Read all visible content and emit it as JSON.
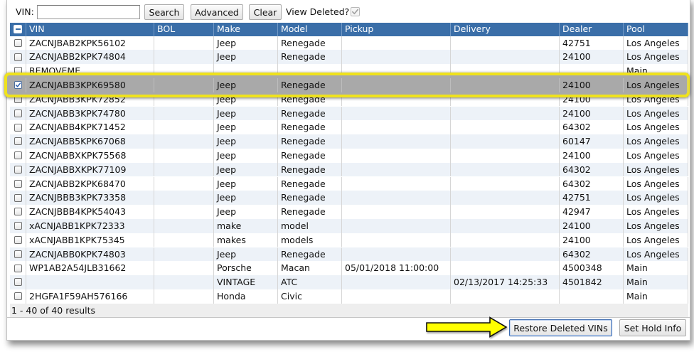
{
  "search": {
    "vin_label": "VIN:",
    "vin_value": "",
    "search_button": "Search",
    "advanced_button": "Advanced",
    "clear_button": "Clear",
    "view_deleted_label": "View Deleted?",
    "view_deleted_checked": true,
    "view_deleted_disabled": true
  },
  "table": {
    "select_all_indeterminate": true,
    "columns": [
      "VIN",
      "BOL",
      "Make",
      "Model",
      "Pickup",
      "Delivery",
      "Dealer",
      "Pool"
    ],
    "rows": [
      {
        "checked": false,
        "cells": [
          "ZACNJBAB2KPK56102",
          "",
          "Jeep",
          "Renegade",
          "",
          "",
          "42751",
          "Los Angeles"
        ]
      },
      {
        "checked": false,
        "cells": [
          "ZACNJABB2KPK74804",
          "",
          "Jeep",
          "Renegade",
          "",
          "",
          "24100",
          "Los Angeles"
        ]
      },
      {
        "checked": false,
        "cells": [
          "REMOVEME",
          "",
          "",
          "",
          "",
          "",
          "",
          "Main"
        ]
      },
      {
        "checked": true,
        "selected": true,
        "cells": [
          "ZACNJABB3KPK69580",
          "",
          "Jeep",
          "Renegade",
          "",
          "",
          "24100",
          "Los Angeles"
        ]
      },
      {
        "checked": false,
        "cells": [
          "ZACNJABB3KPK72852",
          "",
          "Jeep",
          "Renegade",
          "",
          "",
          "24100",
          "Los Angeles"
        ]
      },
      {
        "checked": false,
        "cells": [
          "ZACNJABB3KPK74780",
          "",
          "Jeep",
          "Renegade",
          "",
          "",
          "24100",
          "Los Angeles"
        ]
      },
      {
        "checked": false,
        "cells": [
          "ZACNJABB4KPK71452",
          "",
          "Jeep",
          "Renegade",
          "",
          "",
          "64302",
          "Los Angeles"
        ]
      },
      {
        "checked": false,
        "cells": [
          "ZACNJABB5KPK67068",
          "",
          "Jeep",
          "Renegade",
          "",
          "",
          "60147",
          "Los Angeles"
        ]
      },
      {
        "checked": false,
        "cells": [
          "ZACNJABBXKPK75568",
          "",
          "Jeep",
          "Renegade",
          "",
          "",
          "24100",
          "Los Angeles"
        ]
      },
      {
        "checked": false,
        "cells": [
          "ZACNJABBXKPK77109",
          "",
          "Jeep",
          "Renegade",
          "",
          "",
          "64302",
          "Los Angeles"
        ]
      },
      {
        "checked": false,
        "cells": [
          "ZACNJABB2KPK68470",
          "",
          "Jeep",
          "Renegade",
          "",
          "",
          "64302",
          "Los Angeles"
        ]
      },
      {
        "checked": false,
        "cells": [
          "ZACNJBBB3KPK73358",
          "",
          "Jeep",
          "Renegade",
          "",
          "",
          "42751",
          "Los Angeles"
        ]
      },
      {
        "checked": false,
        "cells": [
          "ZACNJBBB4KPK54043",
          "",
          "Jeep",
          "Renegade",
          "",
          "",
          "42947",
          "Los Angeles"
        ]
      },
      {
        "checked": false,
        "cells": [
          "xACNJABB1KPK72333",
          "",
          "make",
          "model",
          "",
          "",
          "24100",
          "Los Angeles"
        ]
      },
      {
        "checked": false,
        "cells": [
          "xACNJABB1KPK75345",
          "",
          "makes",
          "models",
          "",
          "",
          "24100",
          "Los Angeles"
        ]
      },
      {
        "checked": false,
        "cells": [
          "ZACNJABB0KPK74803",
          "",
          "Jeep",
          "Renegade",
          "",
          "",
          "64302",
          "Los Angeles"
        ]
      },
      {
        "checked": false,
        "cells": [
          "WP1AB2A54JLB31662",
          "",
          "Porsche",
          "Macan",
          "05/01/2018 11:00:00",
          "",
          "4500348",
          "Main"
        ]
      },
      {
        "checked": false,
        "cells": [
          "",
          "",
          "VINTAGE",
          "ATC",
          "",
          "02/13/2017 14:25:33",
          "4501842",
          "Main"
        ]
      },
      {
        "checked": false,
        "cells": [
          "2HGFA1F59AH576166",
          "",
          "Honda",
          "Civic",
          "",
          "",
          "",
          "Main"
        ]
      }
    ]
  },
  "footer": {
    "results": "1 - 40 of 40 results"
  },
  "actions": {
    "restore_deleted_vins": "Restore Deleted VINs",
    "set_hold_info": "Set Hold Info"
  },
  "icons": {
    "select_all": "minus-icon",
    "checked": "check-icon",
    "annotation_arrow": "arrow-right-icon"
  },
  "colors": {
    "header_blue": "#3a6ea8",
    "row_stripe": "#edf2f8",
    "selected_row": "#a9a9a9",
    "callout_yellow": "#efe21c",
    "arrow_yellow": "#ffff00",
    "check_blue": "#2459ad"
  }
}
